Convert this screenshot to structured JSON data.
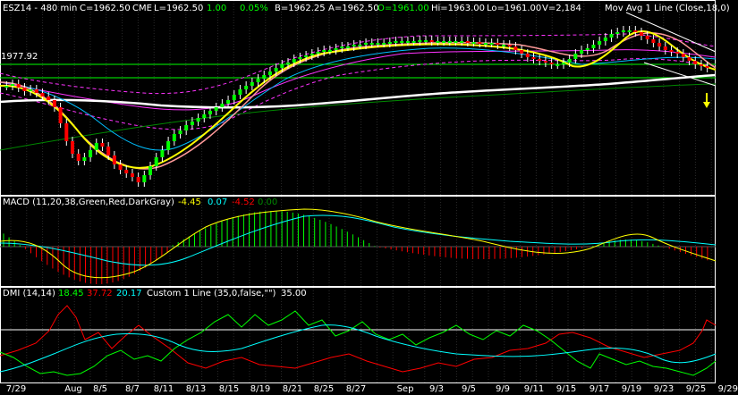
{
  "header": {
    "symbol": "ESZ14 - 480 min",
    "close": "C=1962.50",
    "exchange": "CME",
    "last": "L=1962.50",
    "change": "1.00",
    "pct": "0.05%",
    "bid": "B=1962.25",
    "ask": "A=1962.50",
    "open": "O=1961.00",
    "high": "Hi=1963.00",
    "low": "Lo=1961.00",
    "volume": "V=2,184"
  },
  "price_pane": {
    "price_tag": "1977.92",
    "mov_avg_label": "Mov Avg 1 Line (Close,18,0)"
  },
  "macd_pane": {
    "title": "MACD (11,20,38,Green,Red,DarkGray)",
    "v1": "-4.45",
    "v2": "0.07",
    "v3": "-4.52",
    "v4": "0.00"
  },
  "dmi_pane": {
    "title": "DMI (14,14)",
    "v1": "18.45",
    "v2": "37.72",
    "v3": "20.17",
    "custom": "Custom 1 Line (35,0,false,\"\")",
    "v4": "35.00"
  },
  "x_axis": {
    "labels": [
      "7/29",
      "Aug",
      "8/5",
      "8/7",
      "8/11",
      "8/13",
      "8/15",
      "8/19",
      "8/21",
      "8/25",
      "8/27",
      "Sep",
      "9/3",
      "9/5",
      "9/9",
      "9/11",
      "9/15",
      "9/17",
      "9/19",
      "9/23",
      "9/25",
      "9/29"
    ]
  },
  "colors": {
    "up_candle": "#00ff00",
    "down_candle": "#ff0000",
    "macd_hist_pos": "#00ff00",
    "macd_hist_neg": "#ff0000",
    "macd_line": "#ffff00",
    "signal_line": "#00ffff",
    "dmi_plus": "#00ff00",
    "dmi_minus": "#ff0000",
    "adx": "#00ffff",
    "reference": "#ffffff"
  }
}
